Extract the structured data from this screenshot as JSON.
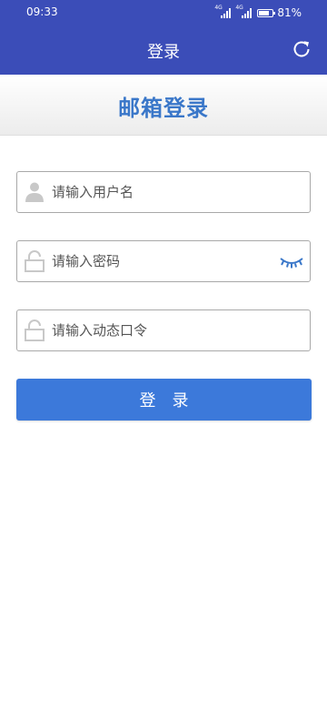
{
  "status_bar": {
    "time": "09:33",
    "network_labels": [
      "4G",
      "4G"
    ],
    "battery_percent": "81%",
    "battery_level": 0.81
  },
  "header": {
    "title": "登录",
    "refresh_icon": "refresh-icon"
  },
  "banner": {
    "title": "邮箱登录"
  },
  "form": {
    "username": {
      "placeholder": "请输入用户名",
      "value": "",
      "icon": "user-icon"
    },
    "password": {
      "placeholder": "请输入密码",
      "value": "",
      "icon": "lock-icon",
      "toggle_icon": "eye-closed-icon"
    },
    "otp": {
      "placeholder": "请输入动态口令",
      "value": "",
      "icon": "lock-icon"
    },
    "submit_label": "登录"
  },
  "colors": {
    "header_bg": "#3b4db8",
    "accent": "#3a77c9",
    "button_bg": "#3c79da",
    "icon_gray": "#c8c8c8"
  }
}
